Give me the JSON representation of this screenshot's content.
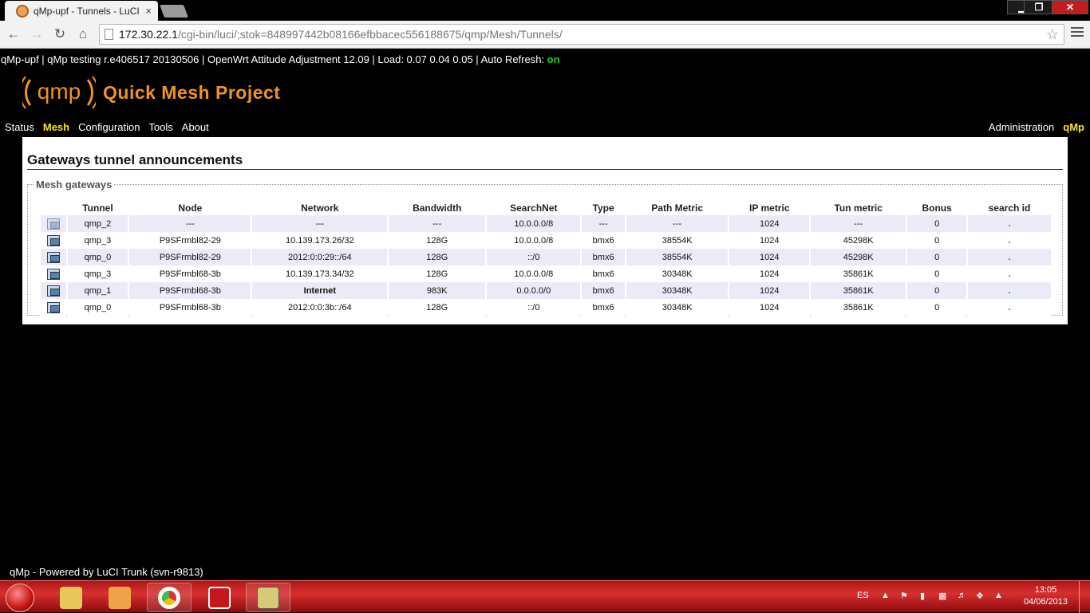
{
  "browser": {
    "tab_title": "qMp-upf - Tunnels - LuCI",
    "tab_close": "×",
    "url_host": "172.30.22.1",
    "url_path": "/cgi-bin/luci/;stok=848997442b08166efbbacec556188675/qmp/Mesh/Tunnels/",
    "minimize": "▁",
    "maximize": "❐",
    "close": "✕"
  },
  "statusline": {
    "text": "qMp-upf | qMp testing r.e406517 20130506 | OpenWrt Attitude Adjustment 12.09 | Load: 0.07 0.04 0.05 | Auto Refresh: ",
    "autorefresh": "on"
  },
  "brand": {
    "logo_text": "qmp",
    "title": "Quick Mesh Project"
  },
  "nav": {
    "items": [
      "Status",
      "Mesh",
      "Configuration",
      "Tools",
      "About"
    ],
    "active": "Mesh",
    "right": {
      "admin": "Administration",
      "qmp": "qMp"
    }
  },
  "main": {
    "heading": "Gateways tunnel announcements",
    "legend": "Mesh gateways",
    "columns": [
      "",
      "Tunnel",
      "Node",
      "Network",
      "Bandwidth",
      "SearchNet",
      "Type",
      "Path Metric",
      "IP metric",
      "Tun metric",
      "Bonus",
      "search id"
    ],
    "rows": [
      [
        "qmp_2",
        "---",
        "---",
        "---",
        "10.0.0.0/8",
        "---",
        "---",
        "1024",
        "---",
        "0",
        "."
      ],
      [
        "qmp_3",
        "P9SFrmbl82-29",
        "10.139.173.26/32",
        "128G",
        "10.0.0.0/8",
        "bmx6",
        "38554K",
        "1024",
        "45298K",
        "0",
        "."
      ],
      [
        "qmp_0",
        "P9SFrmbl82-29",
        "2012:0:0:29::/64",
        "128G",
        "::/0",
        "bmx6",
        "38554K",
        "1024",
        "45298K",
        "0",
        "."
      ],
      [
        "qmp_3",
        "P9SFrmbl68-3b",
        "10.139.173.34/32",
        "128G",
        "10.0.0.0/8",
        "bmx6",
        "30348K",
        "1024",
        "35861K",
        "0",
        "."
      ],
      [
        "qmp_1",
        "P9SFrmbl68-3b",
        "Internet",
        "983K",
        "0.0.0.0/0",
        "bmx6",
        "30348K",
        "1024",
        "35861K",
        "0",
        "."
      ],
      [
        "qmp_0",
        "P9SFrmbl68-3b",
        "2012:0:0:3b::/64",
        "128G",
        "::/0",
        "bmx6",
        "30348K",
        "1024",
        "35861K",
        "0",
        "."
      ]
    ]
  },
  "footer": "qMp - Powered by LuCI Trunk (svn-r9813)",
  "taskbar": {
    "language": "ES",
    "time": "13:05",
    "date": "04/06/2013"
  },
  "colors": {
    "accent": "#f0941e",
    "active_nav": "#f6e61a",
    "on": "#1cd11c"
  }
}
